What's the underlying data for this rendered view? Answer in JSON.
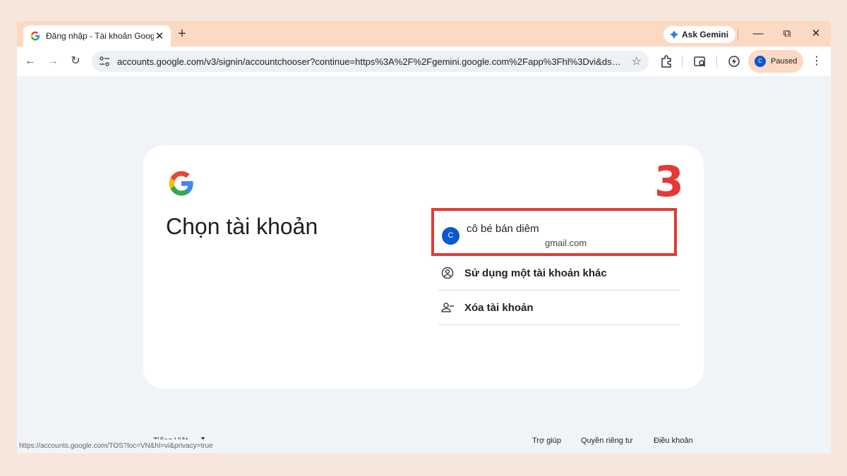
{
  "tab": {
    "title": "Đăng nhập - Tài khoản Google",
    "close": "✕"
  },
  "newtab": "+",
  "gemini": {
    "label": "Ask Gemini"
  },
  "window_controls": {
    "minimize": "—",
    "restore": "⧉",
    "close": "✕"
  },
  "nav": {
    "back": "←",
    "forward": "→",
    "reload": "↻"
  },
  "address": {
    "url": "accounts.google.com/v3/signin/accountchooser?continue=https%3A%2F%2Fgemini.google.com%2Fapp%3Fhl%3Dvi&dsh=S1..."
  },
  "profile": {
    "initial": "C",
    "status": "Paused"
  },
  "menu": "⋮",
  "card": {
    "heading": "Chọn tài khoản",
    "step_marker": "3",
    "account": {
      "initial": "C",
      "name": "cô bé bán diêm",
      "email": "gmail.com"
    },
    "options": [
      {
        "label": "Sử dụng một tài khoản khác",
        "icon": "account-circle-icon"
      },
      {
        "label": "Xóa tài khoản",
        "icon": "person-remove-icon"
      }
    ]
  },
  "footer": {
    "language": "Tiếng Việt",
    "links": [
      "Trợ giúp",
      "Quyền riêng tư",
      "Điều khoản"
    ]
  },
  "statusbar": "https://accounts.google.com/TOS?loc=VN&hl=vi&privacy=true",
  "colors": {
    "accent": "#0b57d0",
    "highlight": "#e53935",
    "tabbar": "#fbd9c2",
    "page_bg": "#f0f4f9"
  }
}
